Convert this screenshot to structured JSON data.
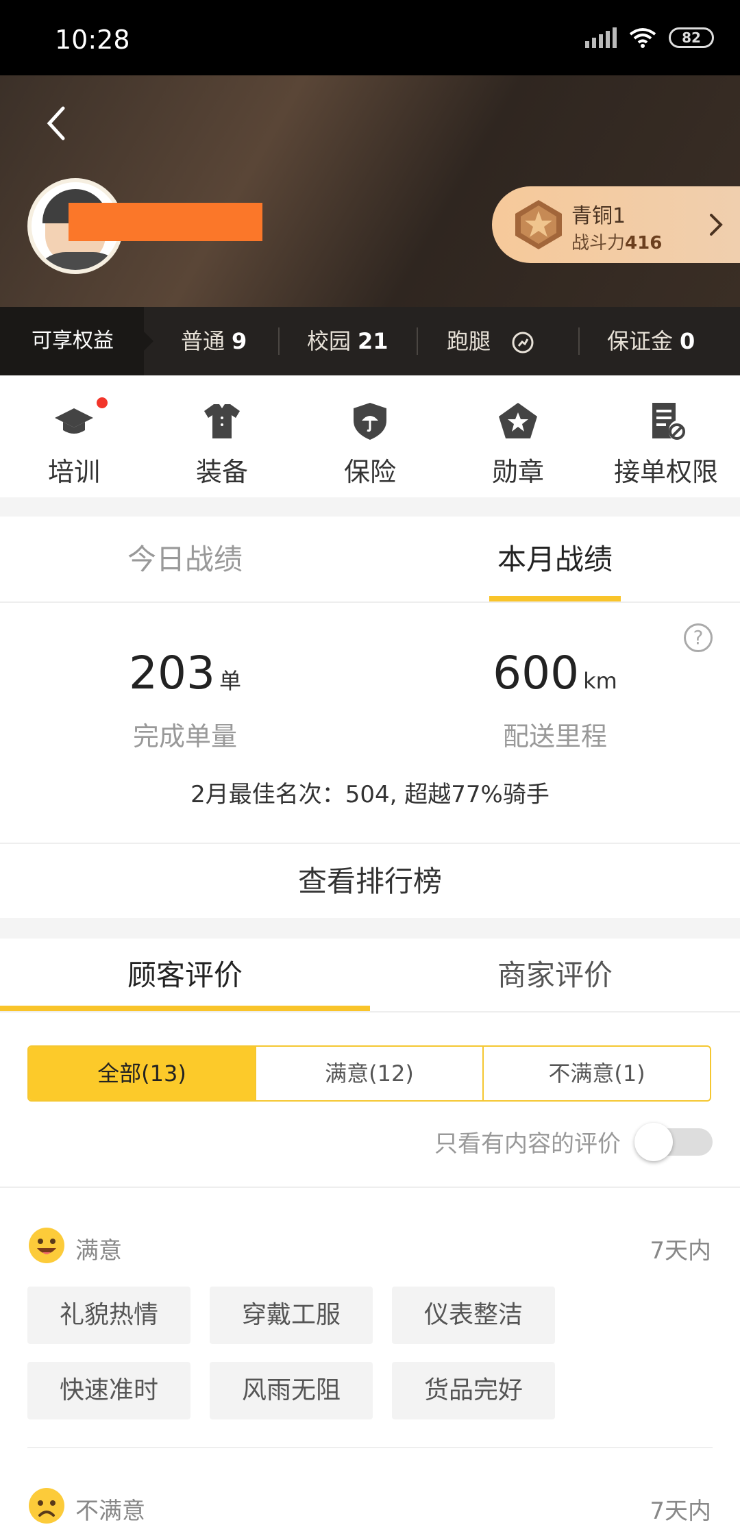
{
  "status": {
    "time": "10:28",
    "battery": "82"
  },
  "profile": {
    "rank_name": "青铜1",
    "power_label": "战斗力",
    "power_value": "416"
  },
  "benefits": {
    "title": "可享权益",
    "items": [
      {
        "label": "普通",
        "value": "9"
      },
      {
        "label": "校园",
        "value": "21"
      },
      {
        "label": "跑腿",
        "value": ""
      },
      {
        "label": "保证金",
        "value": "0"
      }
    ]
  },
  "quick_nav": [
    {
      "label": "培训",
      "icon": "graduation-cap-icon"
    },
    {
      "label": "装备",
      "icon": "shirt-icon"
    },
    {
      "label": "保险",
      "icon": "shield-umbrella-icon"
    },
    {
      "label": "勋章",
      "icon": "medal-icon"
    },
    {
      "label": "接单权限",
      "icon": "document-block-icon"
    }
  ],
  "stats": {
    "tabs": [
      "今日战绩",
      "本月战绩"
    ],
    "active_tab": 1,
    "orders": {
      "value": "203",
      "unit": "单",
      "label": "完成单量"
    },
    "distance": {
      "value": "600",
      "unit": "km",
      "label": "配送里程"
    },
    "best_rank": "2月最佳名次：504, 超越77%骑手",
    "help": "?"
  },
  "ranking_button": "查看排行榜",
  "reviews": {
    "tabs": [
      "顾客评价",
      "商家评价"
    ],
    "active_tab": 0,
    "filters": [
      "全部(13)",
      "满意(12)",
      "不满意(1)"
    ],
    "active_filter": 0,
    "toggle_label": "只看有内容的评价",
    "toggle_on": false,
    "groups": [
      {
        "title": "满意",
        "time": "7天内",
        "tags": [
          "礼貌热情",
          "穿戴工服",
          "仪表整洁",
          "快速准时",
          "风雨无阻",
          "货品完好"
        ]
      },
      {
        "title": "不满意",
        "time": "7天内",
        "tags": []
      }
    ]
  },
  "colors": {
    "accent": "#fcca2a",
    "redact": "#fb7729",
    "dot": "#f2352a"
  }
}
